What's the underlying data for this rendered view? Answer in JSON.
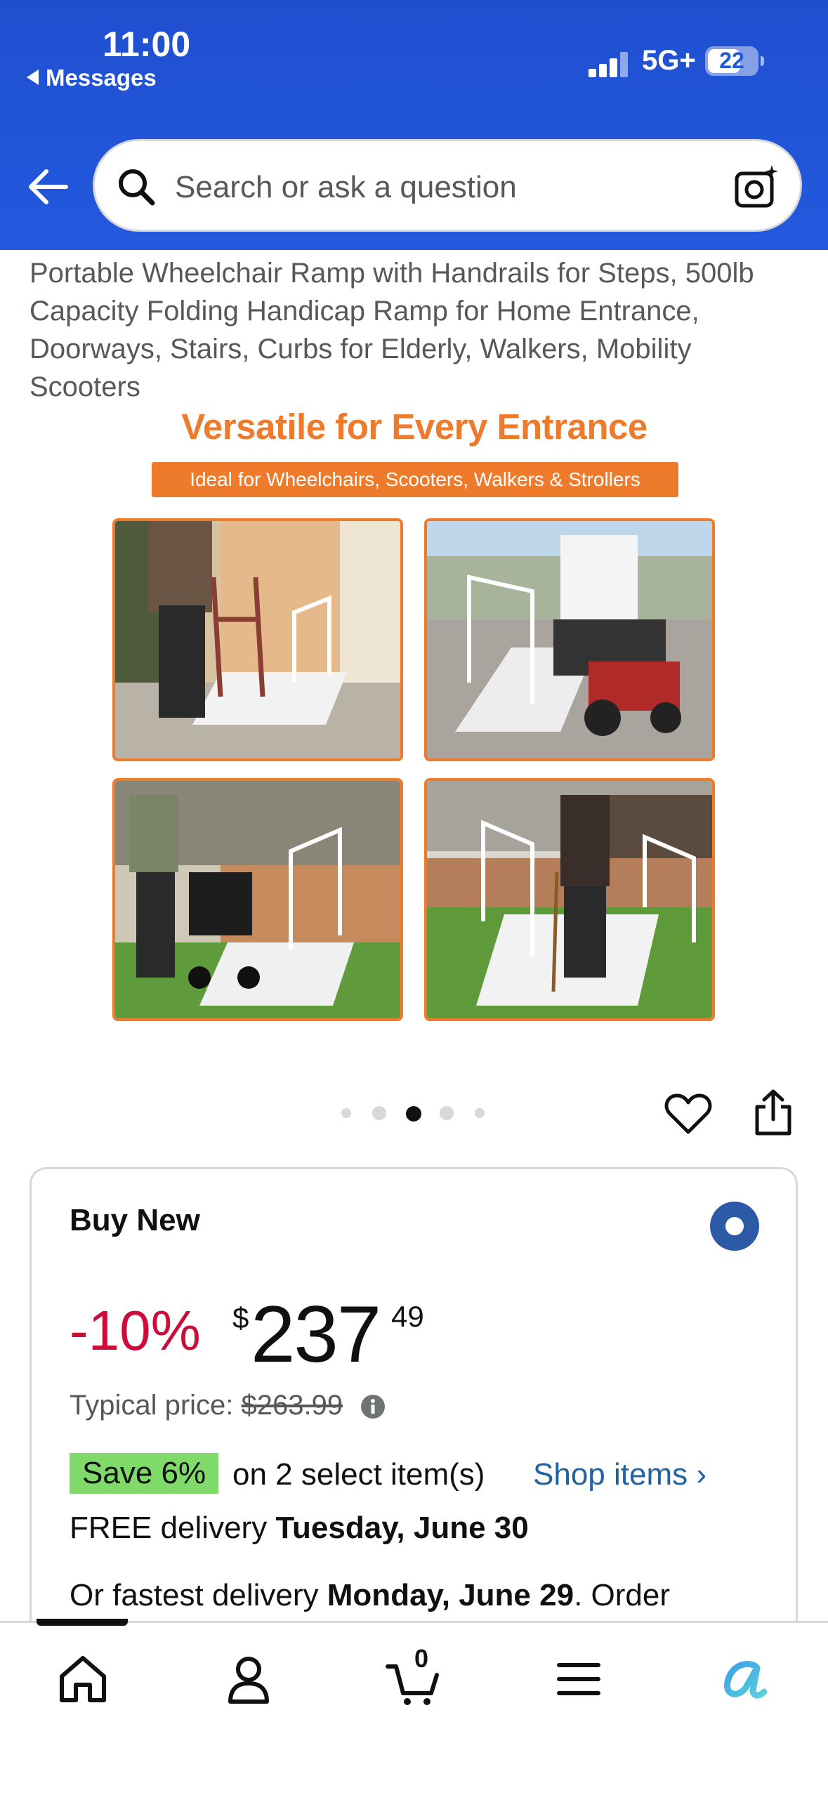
{
  "status_bar": {
    "time": "11:00",
    "back_app": "Messages",
    "network": "5G+",
    "battery": "22"
  },
  "search": {
    "placeholder": "Search or ask a question"
  },
  "product": {
    "title": "Portable Wheelchair Ramp with Handrails for Steps, 500lb Capacity Folding Handicap Ramp for Home Entrance, Doorways, Stairs, Curbs for Elderly, Walkers, Mobility Scooters",
    "promo_headline": "Versatile for Every Entrance",
    "promo_subtitle": "Ideal for Wheelchairs, Scooters, Walkers & Strollers",
    "image_index": 3,
    "image_count": 5
  },
  "buy_box": {
    "heading": "Buy New",
    "discount": "-10%",
    "currency": "$",
    "price_whole": "237",
    "price_fraction": "49",
    "typical_label": "Typical price:",
    "typical_value": "$263.99",
    "save_badge": "Save 6%",
    "select_items": "on 2 select item(s)",
    "shop_items": "Shop items ›",
    "delivery_prefix": "FREE delivery ",
    "delivery_date": "Tuesday, June 30",
    "fastest_prefix": "Or fastest delivery ",
    "fastest_date": "Monday, June 29",
    "fastest_suffix": ". Order"
  },
  "bottom_nav": {
    "cart_count": "0"
  },
  "colors": {
    "header_blue": "#2459de",
    "accent_orange": "#ee7a2c",
    "deal_red": "#cc0c39",
    "link_blue": "#2162a1",
    "save_green": "#7fda69"
  }
}
